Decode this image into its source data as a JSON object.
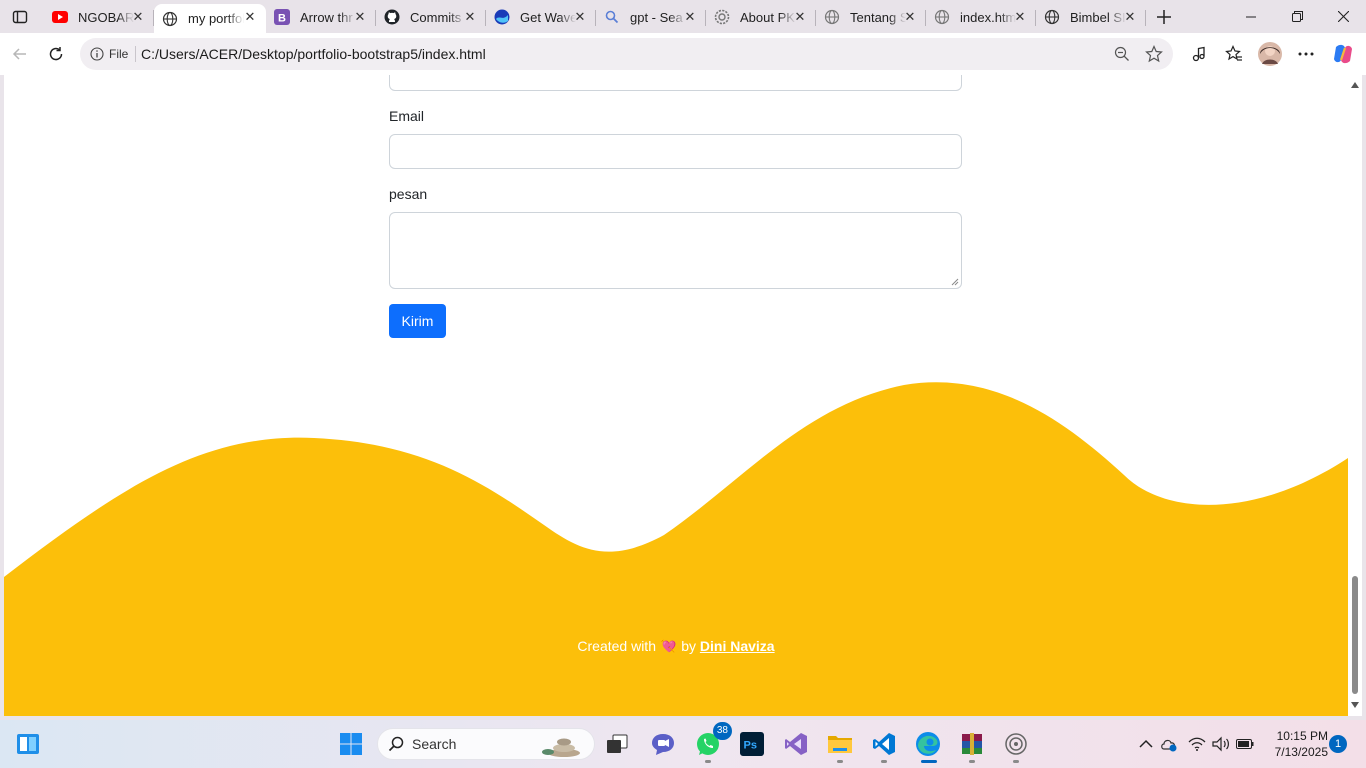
{
  "browser": {
    "tabs": [
      {
        "title": "NGOBAR",
        "icon": "youtube-icon"
      },
      {
        "title": "my portfolio",
        "icon": "globe-icon",
        "active": true
      },
      {
        "title": "Arrow thr",
        "icon": "bootstrap-icon"
      },
      {
        "title": "Commits",
        "icon": "github-icon"
      },
      {
        "title": "Get Wave",
        "icon": "wave-icon"
      },
      {
        "title": "gpt - Sea",
        "icon": "search-icon"
      },
      {
        "title": "About PK",
        "icon": "gear-icon"
      },
      {
        "title": "Tentang S",
        "icon": "globe-icon"
      },
      {
        "title": "index.htm",
        "icon": "globe-icon"
      },
      {
        "title": "Bimbel SI",
        "icon": "globe-icon"
      }
    ],
    "close_glyph": "✕",
    "address_bar": {
      "scheme_label": "File",
      "url": "C:/Users/ACER/Desktop/portfolio-bootstrap5/index.html"
    }
  },
  "page": {
    "email_label": "Email",
    "message_label": "pesan",
    "submit_label": "Kirim",
    "footer": {
      "prefix": "Created with",
      "emoji": "💘",
      "by": "by",
      "author": "Dini Naviza"
    },
    "colors": {
      "wave": "#fcbf0a",
      "primary_button": "#0d6efd"
    }
  },
  "taskbar": {
    "search_placeholder": "Search",
    "whatsapp_badge": "38",
    "time": "10:15 PM",
    "date": "7/13/2025",
    "notification_count": "1"
  }
}
